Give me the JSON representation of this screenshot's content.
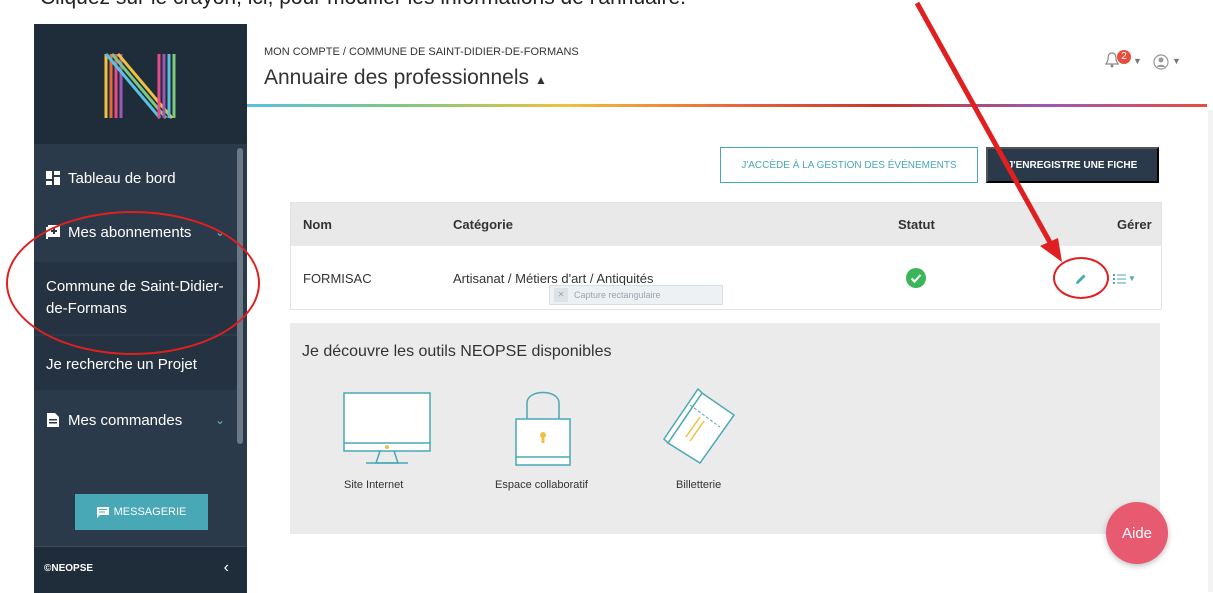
{
  "doc_text": "Cliquez sur le crayon, ici, pour modifier les informations de l'annuaire.",
  "sidebar": {
    "nav": [
      {
        "label": "Tableau de bord",
        "icon": "dashboard-icon"
      },
      {
        "label": "Mes abonnements",
        "icon": "subscriptions-icon"
      },
      {
        "label": "Commune de Saint-Didier-de-Formans"
      },
      {
        "label": "Je recherche un Projet"
      },
      {
        "label": "Mes commandes",
        "icon": "orders-icon"
      }
    ],
    "messagerie_label": "MESSAGERIE",
    "footer_text": "©NEOPSE"
  },
  "header": {
    "breadcrumb": "MON COMPTE / COMMUNE DE SAINT-DIDIER-DE-FORMANS",
    "title": "Annuaire des professionnels",
    "notification_count": "2"
  },
  "actions": {
    "events_label": "J'ACCÈDE À LA GESTION DES ÉVÉNEMENTS",
    "register_label": "J'ENREGISTRE UNE FICHE"
  },
  "table": {
    "headers": [
      "Nom",
      "Catégorie",
      "Statut",
      "Gérer"
    ],
    "rows": [
      {
        "name": "FORMISAC",
        "category": "Artisanat / Métiers d'art / Antiquités",
        "status": "ok"
      }
    ],
    "tooltip": "Capture rectangulaire"
  },
  "tools": {
    "title": "Je découvre les outils NEOPSE disponibles",
    "items": [
      {
        "label": "Site Internet",
        "icon": "monitor-icon"
      },
      {
        "label": "Espace collaboratif",
        "icon": "padlock-icon"
      },
      {
        "label": "Billetterie",
        "icon": "tickets-icon"
      }
    ]
  },
  "help_label": "Aide",
  "colors": {
    "sidebar": "#2b3a4a",
    "accent": "#48a8b6",
    "annotation": "#e02020",
    "help": "#e85a70",
    "status_ok": "#3cb55a"
  }
}
